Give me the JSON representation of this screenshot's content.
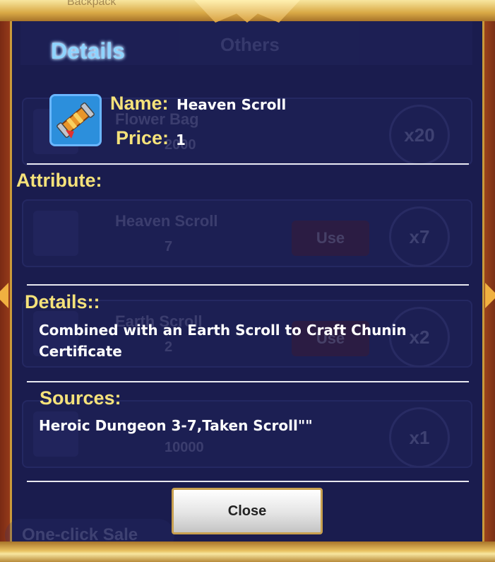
{
  "background": {
    "top_label": "Backpack",
    "tab_others": "Others",
    "rows": [
      {
        "name": "Flower Bag",
        "qty": "2000",
        "multiplier": "x20",
        "use": ""
      },
      {
        "name": "Heaven Scroll",
        "qty": "7",
        "multiplier": "x7",
        "use": "Use"
      },
      {
        "name": "Earth Scroll",
        "qty": "2",
        "multiplier": "x2",
        "use": "Use"
      },
      {
        "name": "",
        "qty": "10000",
        "multiplier": "x1",
        "use": ""
      }
    ],
    "one_click_sale": "One-click Sale"
  },
  "dialog": {
    "title": "Details",
    "item": {
      "icon": "scroll-icon",
      "name_label": "Name:",
      "name_value": "Heaven Scroll",
      "price_label": "Price:",
      "price_value": "1"
    },
    "attribute_label": "Attribute:",
    "details_label": "Details::",
    "details_text": "Combined with an Earth Scroll to Craft Chunin Certificate",
    "sources_label": "Sources:",
    "sources_text": "Heroic Dungeon 3-7,Taken Scroll\"\"",
    "close_label": "Close"
  },
  "colors": {
    "panel": "#1a1c4e",
    "label_gold": "#f5e27a",
    "title_blue": "#8fd4ff",
    "frame_gold": "#c99a3a"
  }
}
